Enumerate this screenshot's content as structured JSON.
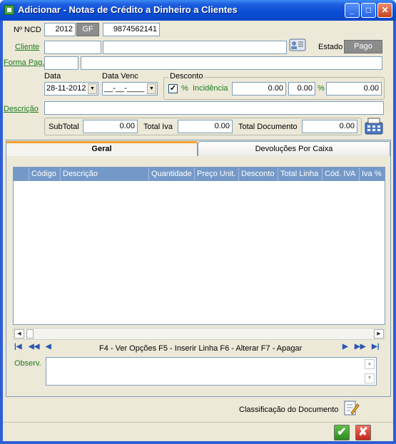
{
  "window": {
    "title": "Adicionar - Notas de Crédito a Dinheiro a Clientes",
    "min_symbol": "_",
    "max_symbol": "□",
    "close_symbol": "✕"
  },
  "form": {
    "ncd_label": "Nº NCD",
    "ncd_year": "2012",
    "ncd_series": "GF",
    "ncd_number": "9874562141",
    "cliente_label": "Cliente",
    "cliente_code": "",
    "cliente_name": "",
    "estado_label": "Estado",
    "estado_value": "Pago",
    "forma_pag_label": "Forma Pag.",
    "forma_pag_code": "",
    "forma_pag_desc": "",
    "data_label": "Data",
    "data_value": "28-11-2012",
    "data_venc_label": "Data Venc",
    "data_venc_value": "__-__-____",
    "desconto_label": "Desconto",
    "desconto_checked": "✓",
    "percent_symbol": "%",
    "incidencia_label": "Incidência",
    "desconto_val1": "0.00",
    "desconto_val2": "0.00",
    "desconto_pct_symbol": "%",
    "desconto_val3": "0.00",
    "descricao_label": "Descrição",
    "descricao_value": "",
    "subtotal_label": "SubTotal",
    "subtotal_value": "0.00",
    "total_iva_label": "Total Iva",
    "total_iva_value": "0.00",
    "total_doc_label": "Total Documento",
    "total_doc_value": "0.00"
  },
  "tabs": [
    {
      "label": "Geral",
      "active": true
    },
    {
      "label": "Devoluções Por Caixa",
      "active": false
    }
  ],
  "grid": {
    "columns": [
      "Código",
      "Descrição",
      "Quantidade",
      "Preço Unit.",
      "Desconto",
      "Total Linha",
      "Cód. IVA",
      "Iva %"
    ],
    "rows": []
  },
  "nav": {
    "first": "|◀",
    "prev_page": "◀◀",
    "prev": "◀",
    "shortcuts": "F4 - Ver Opções  F5 - Inserir Linha   F6 - Alterar   F7 - Apagar",
    "next": "▶",
    "next_page": "▶▶",
    "last": "▶|"
  },
  "observ_label": "Observ.",
  "observ_value": "",
  "classificacao_label": "Classificação do Documento",
  "buttons": {
    "ok_symbol": "✔",
    "cancel_symbol": "✘"
  },
  "colors": {
    "ok": "#3a9a28",
    "cancel": "#d2331f",
    "title_blue": "#0a4fd8",
    "link_green": "#1d7a1d"
  },
  "icons": [
    "cliente-card-icon",
    "calculator-icon",
    "classificacao-edit-icon"
  ]
}
